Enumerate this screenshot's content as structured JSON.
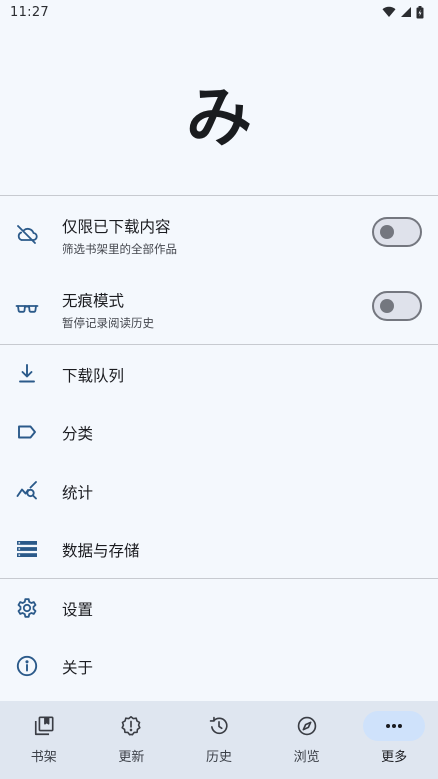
{
  "status_bar": {
    "time": "11:27"
  },
  "logo": {
    "text": "み"
  },
  "toggles": [
    {
      "title": "仅限已下载内容",
      "subtitle": "筛选书架里的全部作品",
      "enabled": false,
      "icon": "cloud-off-icon"
    },
    {
      "title": "无痕模式",
      "subtitle": "暂停记录阅读历史",
      "enabled": false,
      "icon": "glasses-icon"
    }
  ],
  "menu": [
    {
      "label": "下载队列",
      "icon": "download-icon"
    },
    {
      "label": "分类",
      "icon": "label-icon"
    },
    {
      "label": "统计",
      "icon": "stats-search-icon"
    },
    {
      "label": "数据与存储",
      "icon": "storage-icon"
    },
    {
      "label": "设置",
      "icon": "gear-icon"
    },
    {
      "label": "关于",
      "icon": "info-icon"
    }
  ],
  "bottom_nav": [
    {
      "label": "书架",
      "icon": "library-icon",
      "active": false
    },
    {
      "label": "更新",
      "icon": "updates-icon",
      "active": false
    },
    {
      "label": "历史",
      "icon": "history-icon",
      "active": false
    },
    {
      "label": "浏览",
      "icon": "compass-icon",
      "active": false
    },
    {
      "label": "更多",
      "icon": "more-icon",
      "active": true
    }
  ],
  "colors": {
    "accent_icon": "#2b5a8a",
    "background": "#f4f8fd",
    "nav_background": "#dfe6f0",
    "active_pill": "#cfe2fb"
  }
}
